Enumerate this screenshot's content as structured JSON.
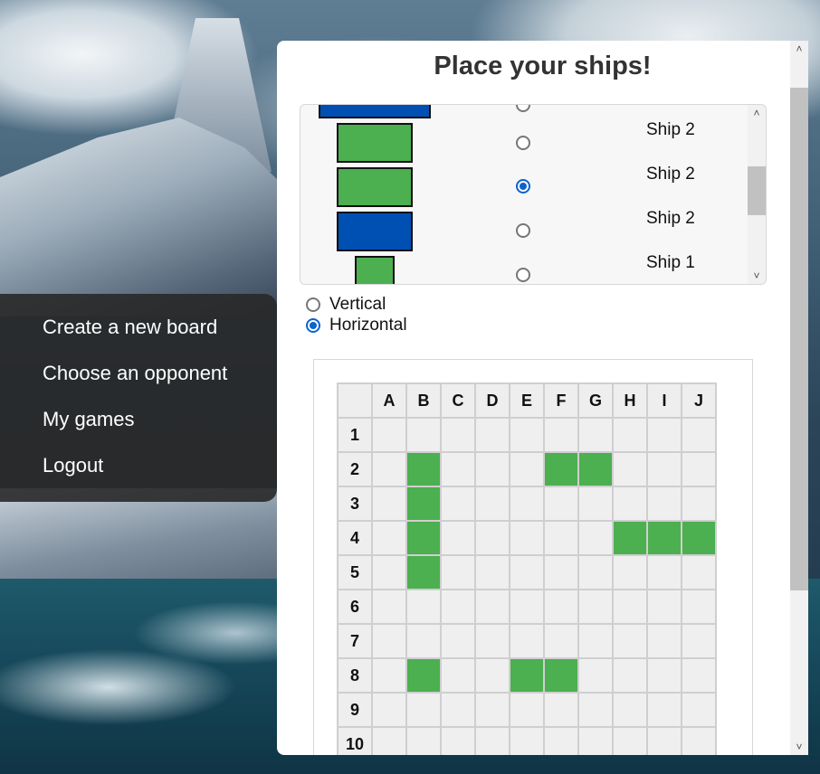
{
  "menu": {
    "items": [
      {
        "label": "Create a new board"
      },
      {
        "label": "Choose an opponent"
      },
      {
        "label": "My games"
      },
      {
        "label": "Logout"
      }
    ]
  },
  "panel": {
    "title": "Place your ships!"
  },
  "ship_list": {
    "rows": [
      {
        "name": "",
        "color": "#0050b3",
        "selected": false
      },
      {
        "name": "Ship 2",
        "color": "#4caf50",
        "selected": false
      },
      {
        "name": "Ship 2",
        "color": "#4caf50",
        "selected": true
      },
      {
        "name": "Ship 2",
        "color": "#0050b3",
        "selected": false
      },
      {
        "name": "Ship 1",
        "color": "#4caf50",
        "selected": false
      }
    ]
  },
  "orientation": {
    "options": [
      {
        "label": "Vertical",
        "checked": false
      },
      {
        "label": "Horizontal",
        "checked": true
      }
    ]
  },
  "board": {
    "columns": [
      "A",
      "B",
      "C",
      "D",
      "E",
      "F",
      "G",
      "H",
      "I",
      "J"
    ],
    "rows": [
      "1",
      "2",
      "3",
      "4",
      "5",
      "6",
      "7",
      "8",
      "9",
      "10"
    ],
    "ships": [
      "B2",
      "F2",
      "G2",
      "B3",
      "B4",
      "H4",
      "I4",
      "J4",
      "B5",
      "B8",
      "E8",
      "F8"
    ],
    "ship_color": "#4caf50",
    "empty_color": "#efefef"
  },
  "colors": {
    "accent": "#0b63ce",
    "menu_bg": "#282828",
    "ship_green": "#4caf50",
    "ship_blue": "#0050b3"
  }
}
